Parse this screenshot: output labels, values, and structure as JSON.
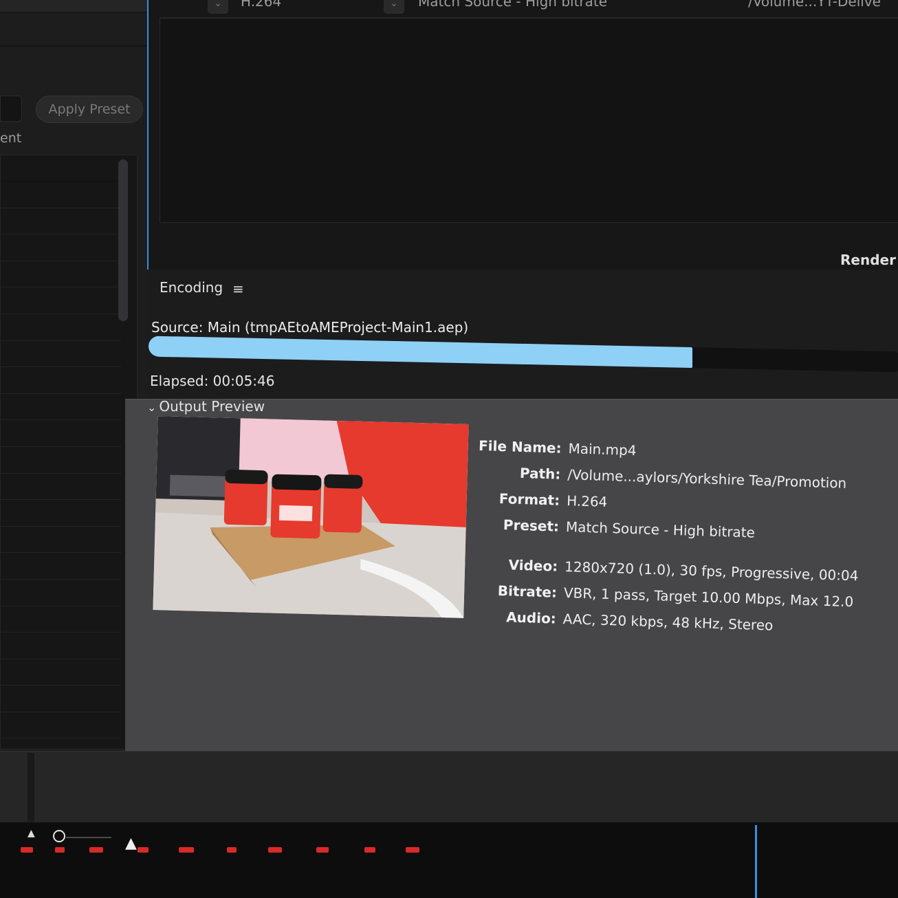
{
  "left_panel": {
    "apply_preset_label": "Apply Preset",
    "partial_label": "ent"
  },
  "queue": {
    "format": "H.264",
    "preset": "Match Source - High bitrate",
    "output_path": "/Volume...YT-Delive",
    "render_label": "Render"
  },
  "encoding": {
    "title": "Encoding",
    "menu_icon": "hamburger-menu-icon",
    "source": "Source: Main (tmpAEtoAMEProject-Main1.aep)",
    "progress": 0.72,
    "progress_color": "#8fd0f6",
    "elapsed": "Elapsed: 00:05:46"
  },
  "output_preview": {
    "header": "Output Preview",
    "details": {
      "file_name_label": "File Name:",
      "file_name": "Main.mp4",
      "path_label": "Path:",
      "path": "/Volume...aylors/Yorkshire Tea/Promotion",
      "format_label": "Format:",
      "format": "H.264",
      "preset_label": "Preset:",
      "preset": "Match Source - High bitrate",
      "video_label": "Video:",
      "video": "1280x720 (1.0), 30 fps, Progressive, 00:04",
      "bitrate_label": "Bitrate:",
      "bitrate": "VBR, 1 pass, Target 10.00 Mbps, Max 12.0",
      "audio_label": "Audio:",
      "audio": "AAC, 320 kbps, 48 kHz, Stereo"
    }
  },
  "colors": {
    "accent_blue": "#3a8fe0",
    "thumbnail_red": "#e63a2e"
  },
  "bottom": {
    "zoom_out_icon": "small-mountain-icon",
    "zoom_in_icon": "large-mountain-icon"
  }
}
